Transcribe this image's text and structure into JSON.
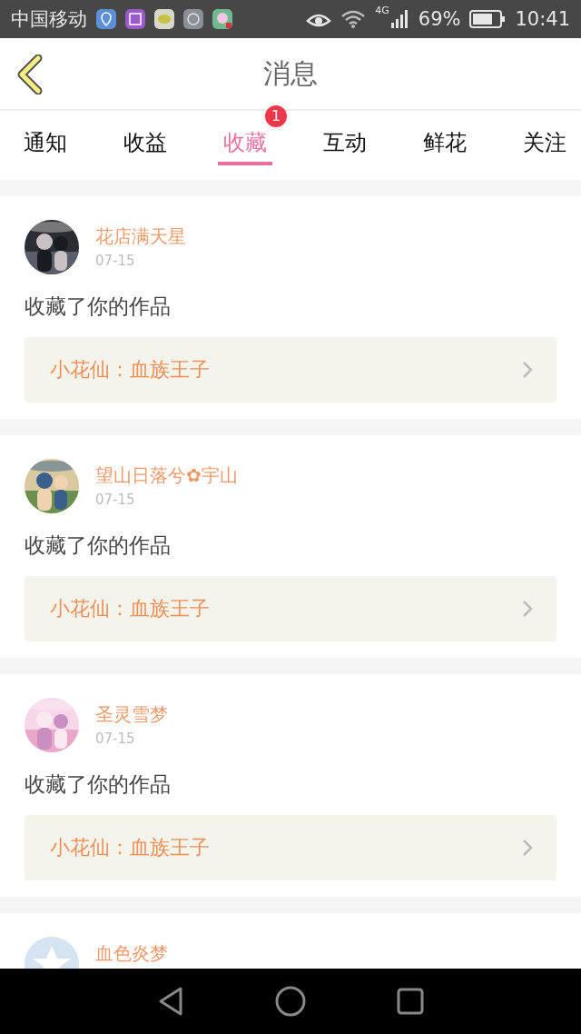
{
  "status_bar": {
    "carrier": "中国移动",
    "network": "4G",
    "battery": "69%",
    "time": "10:41"
  },
  "header": {
    "title": "消息"
  },
  "tabs": [
    {
      "label": "通知",
      "selected": false
    },
    {
      "label": "收益",
      "selected": false
    },
    {
      "label": "收藏",
      "selected": true,
      "badge": "1"
    },
    {
      "label": "互动",
      "selected": false
    },
    {
      "label": "鲜花",
      "selected": false
    },
    {
      "label": "关注",
      "selected": false
    }
  ],
  "messages": [
    {
      "kind": "picture",
      "name": "花店满天星",
      "date": "07-15",
      "action": "收藏了你的作品",
      "work": "小花仙：血族王子"
    },
    {
      "kind": "picture",
      "name": "望山日落兮✿宇山",
      "date": "07-15",
      "action": "收藏了你的作品",
      "work": "小花仙：血族王子"
    },
    {
      "kind": "picture",
      "name": "圣灵雪梦",
      "date": "07-15",
      "action": "收藏了你的作品",
      "work": "小花仙：血族王子"
    },
    {
      "kind": "default",
      "name": "血色炎梦"
    }
  ]
}
